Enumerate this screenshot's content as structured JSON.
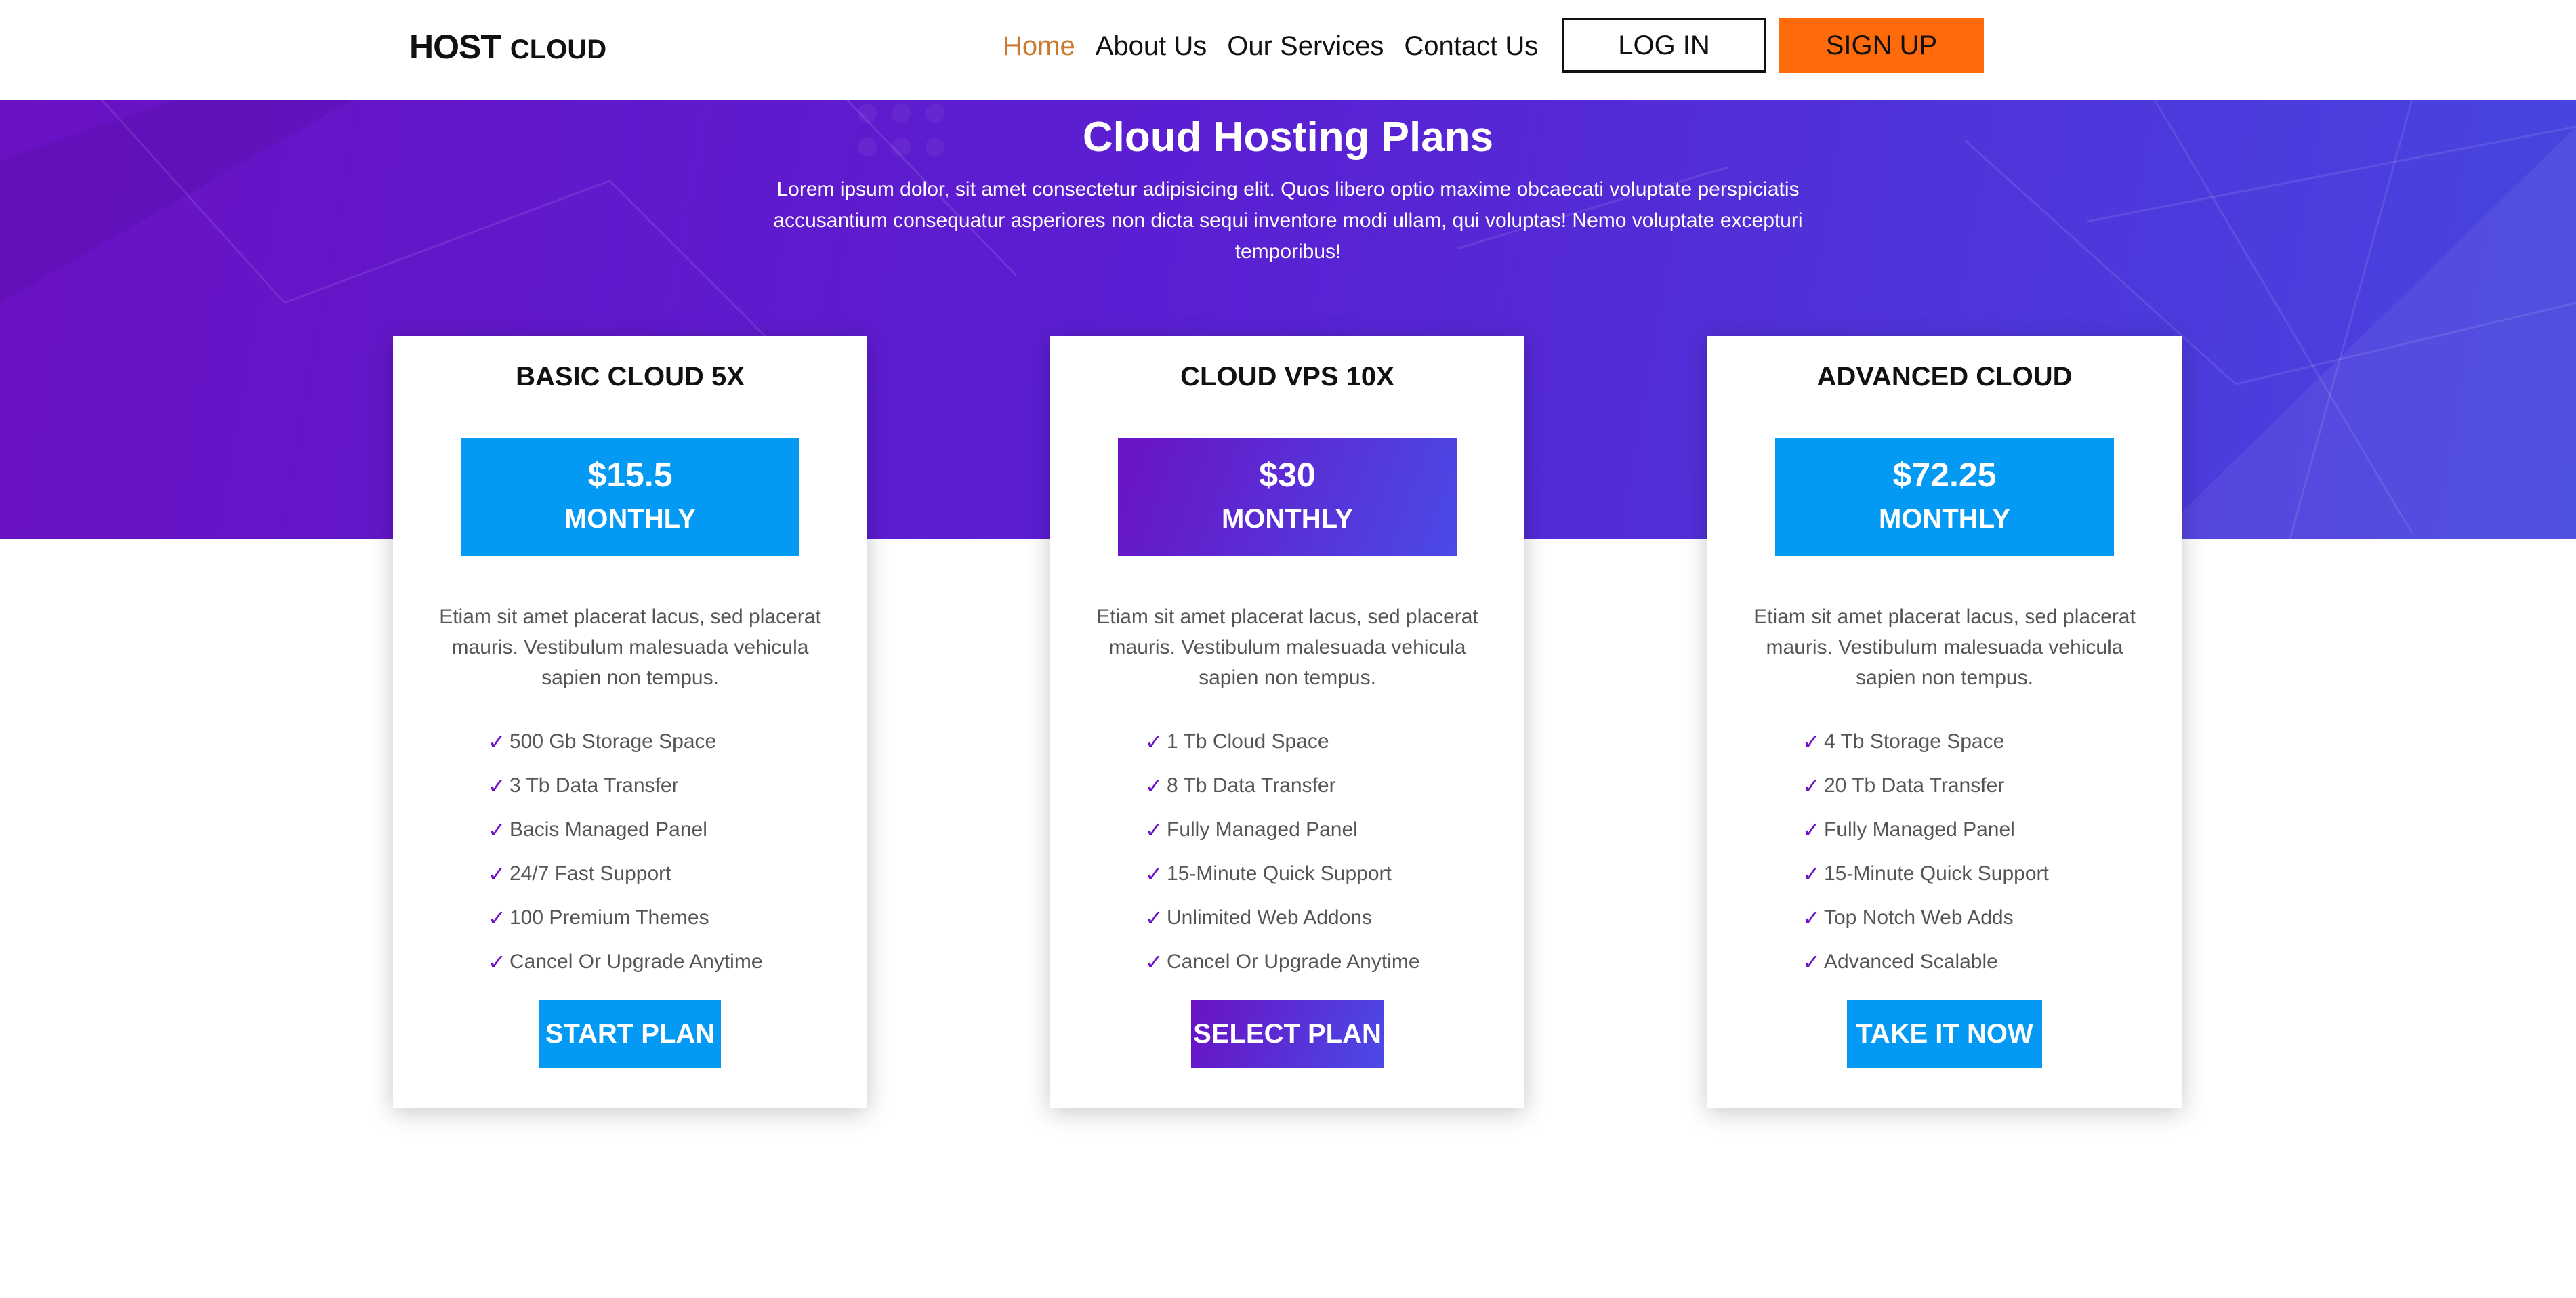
{
  "header": {
    "logo_main": "HOST",
    "logo_sub": "CLOUD",
    "nav": [
      {
        "label": "Home",
        "active": true
      },
      {
        "label": "About Us",
        "active": false
      },
      {
        "label": "Our Services",
        "active": false
      },
      {
        "label": "Contact Us",
        "active": false
      }
    ],
    "login_label": "LOG IN",
    "signup_label": "SIGN UP"
  },
  "hero": {
    "title": "Cloud Hosting Plans",
    "text": "Lorem ipsum dolor, sit amet consectetur adipisicing elit. Quos libero optio maxime obcaecati voluptate perspiciatis accusantium consequatur asperiores non dicta sequi inventore modi ullam, qui voluptas! Nemo voluptate excepturi temporibus!"
  },
  "plans": [
    {
      "title": "BASIC CLOUD 5X",
      "price": "$15.5",
      "period": "MONTHLY",
      "description": "Etiam sit amet placerat lacus, sed placerat mauris. Vestibulum malesuada vehicula sapien non tempus.",
      "features": [
        "500 Gb Storage Space",
        "3 Tb Data Transfer",
        "Bacis Managed Panel",
        "24/7 Fast Support",
        "100 Premium Themes",
        "Cancel Or Upgrade Anytime"
      ],
      "button_label": "START PLAN"
    },
    {
      "title": "CLOUD VPS 10X",
      "price": "$30",
      "period": "MONTHLY",
      "description": "Etiam sit amet placerat lacus, sed placerat mauris. Vestibulum malesuada vehicula sapien non tempus.",
      "features": [
        "1 Tb Cloud Space",
        "8 Tb Data Transfer",
        "Fully Managed Panel",
        "15-Minute Quick Support",
        "Unlimited Web Addons",
        "Cancel Or Upgrade Anytime"
      ],
      "button_label": "SELECT PLAN"
    },
    {
      "title": "ADVANCED CLOUD",
      "price": "$72.25",
      "period": "MONTHLY",
      "description": "Etiam sit amet placerat lacus, sed placerat mauris. Vestibulum malesuada vehicula sapien non tempus.",
      "features": [
        "4 Tb Storage Space",
        "20 Tb Data Transfer",
        "Fully Managed Panel",
        "15-Minute Quick Support",
        "Top Notch Web Adds",
        "Advanced Scalable"
      ],
      "button_label": "TAKE IT NOW"
    }
  ],
  "icons": {
    "feature_check": "check-icon"
  },
  "colors": {
    "accent_blue": "#0499f2",
    "accent_orange": "#ff6a0a",
    "nav_active": "#c97a2c",
    "hero_gradient_start": "#6a11c4",
    "hero_gradient_end": "#4646e0",
    "check_color": "#6a12c4"
  }
}
